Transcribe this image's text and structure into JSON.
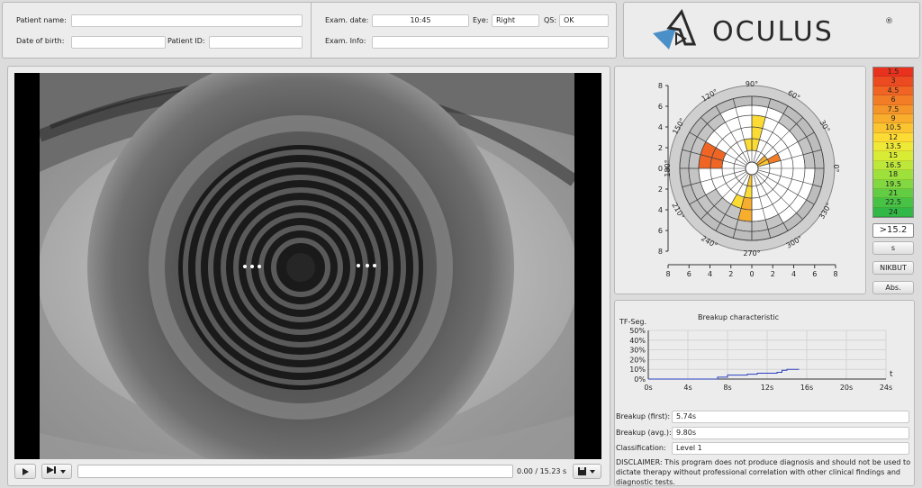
{
  "patient": {
    "name_label": "Patient name:",
    "name_value": "",
    "dob_label": "Date of birth:",
    "dob_value": "",
    "id_label": "Patient ID:",
    "id_value": ""
  },
  "exam": {
    "date_label": "Exam. date:",
    "date_value": "10:45",
    "eye_label": "Eye:",
    "eye_value": "Right",
    "qs_label": "QS:",
    "qs_value": "OK",
    "info_label": "Exam. Info:",
    "info_value": ""
  },
  "logo": {
    "text": "OCULUS",
    "registered": "®"
  },
  "polar": {
    "y_ticks": [
      "8",
      "6",
      "4",
      "2",
      "0",
      "2",
      "4",
      "6",
      "8"
    ],
    "x_ticks": [
      "8",
      "6",
      "4",
      "2",
      "0",
      "2",
      "4",
      "6",
      "8"
    ],
    "angle_labels": [
      "90°",
      "60°",
      "30°",
      "0°",
      "330°",
      "300°",
      "270°",
      "240°",
      "210°",
      "180°",
      "150°",
      "120°"
    ]
  },
  "scale": [
    {
      "label": "1.5",
      "color": "#e8321e"
    },
    {
      "label": "3",
      "color": "#ec4a20"
    },
    {
      "label": "4.5",
      "color": "#f06424"
    },
    {
      "label": "6",
      "color": "#f37d27"
    },
    {
      "label": "7.5",
      "color": "#f5962a"
    },
    {
      "label": "9",
      "color": "#f8ad2d"
    },
    {
      "label": "10.5",
      "color": "#fac530"
    },
    {
      "label": "12",
      "color": "#fcdc34"
    },
    {
      "label": "13.5",
      "color": "#eee836"
    },
    {
      "label": "15",
      "color": "#d8ec36"
    },
    {
      "label": "16.5",
      "color": "#bde83a"
    },
    {
      "label": "18",
      "color": "#9ee03c"
    },
    {
      "label": "19.5",
      "color": "#82d840"
    },
    {
      "label": "21",
      "color": "#62cd42"
    },
    {
      "label": "22.5",
      "color": "#48c244"
    },
    {
      "label": "24",
      "color": "#32b846"
    }
  ],
  "scale_value": ">15.2",
  "buttons": {
    "s": "s",
    "nikbut": "NIKBUT",
    "abs": "Abs."
  },
  "breakup_chart": {
    "title": "Breakup characteristic",
    "ylabel": "TF-Seg.",
    "xlabel": "t",
    "y_ticks": [
      "50%",
      "40%",
      "30%",
      "20%",
      "10%",
      "0%"
    ],
    "x_ticks": [
      "0s",
      "4s",
      "8s",
      "12s",
      "16s",
      "20s",
      "24s"
    ]
  },
  "chart_data": {
    "type": "line",
    "title": "Breakup characteristic",
    "xlabel": "t",
    "ylabel": "TF-Seg.",
    "xlim": [
      0,
      24
    ],
    "ylim": [
      0,
      50
    ],
    "series": [
      {
        "values_x": [
          0,
          5.74,
          7.0,
          8.0,
          9.0,
          10.0,
          11.0,
          12.0,
          13.0,
          13.5,
          14.0,
          15.23
        ],
        "values_y": [
          0,
          0,
          2,
          4,
          4,
          5,
          6,
          6,
          7,
          9,
          10,
          10
        ]
      }
    ]
  },
  "results": {
    "first_label": "Breakup (first):",
    "first_value": "5.74s",
    "avg_label": "Breakup (avg.):",
    "avg_value": "9.80s",
    "class_label": "Classification:",
    "class_value": "Level 1"
  },
  "disclaimer": "DISCLAIMER: This program does not produce diagnosis and should not be used to dictate therapy without professional correlation with other clinical findings and diagnostic tests.",
  "player": {
    "time": "0.00 / 15.23 s",
    "progress": 0.0
  },
  "icons": {
    "play": "play-icon",
    "slow": "slow-motion-icon",
    "save": "save-icon"
  }
}
